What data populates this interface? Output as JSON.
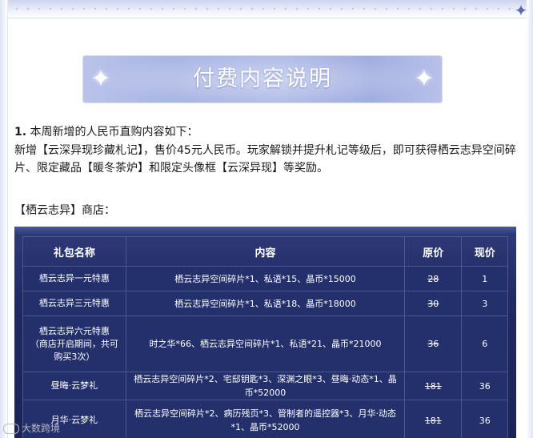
{
  "banner": {
    "title": "付费内容说明"
  },
  "intro": {
    "number": "1.",
    "heading": "本周新增的人民币直购内容如下：",
    "body": "新增【云深异现珍藏札记】，售价45元人民币。玩家解锁并提升札记等级后，即可获得栖云志异空间碎片、限定藏品【暖冬茶炉】和限定头像框【云深异现】等奖励。",
    "shop_label": "【栖云志异】商店："
  },
  "table": {
    "headers": [
      "礼包名称",
      "内容",
      "原价",
      "现价"
    ],
    "rows": [
      {
        "name": "栖云志异一元特惠",
        "content": "栖云志异空间碎片*1、私语*15、晶币*15000",
        "original": "28",
        "current": "1"
      },
      {
        "name": "栖云志异三元特惠",
        "content": "栖云志异空间碎片*1、私语*18、晶币*18000",
        "original": "30",
        "current": "3"
      },
      {
        "name": "栖云志异六元特惠\n（商店开启期间，共可购买3次）",
        "content": "时之华*66、栖云志异空间碎片*1、私语*21、晶币*21000",
        "original": "36",
        "current": "6"
      },
      {
        "name": "昼晦·云梦礼",
        "content": "栖云志异空间碎片*2、宅邸钥匙*3、深渊之眼*3、昼晦·动态*1、晶币*52000",
        "original": "181",
        "current": "36"
      },
      {
        "name": "月华·云梦礼",
        "content": "栖云志异空间碎片*2、病历残页*3、管制者的遥控器*3、月华·动态*1、晶币*52000",
        "original": "181",
        "current": "36"
      }
    ]
  },
  "watermark": {
    "text": "大数跨境"
  },
  "icons": {
    "corner": "four-point-star-icon",
    "banner_left": "sparkle-icon",
    "banner_right": "sparkle-icon"
  },
  "colors": {
    "table_bg": "#23306c",
    "banner_bg": "#a9b5e4"
  }
}
